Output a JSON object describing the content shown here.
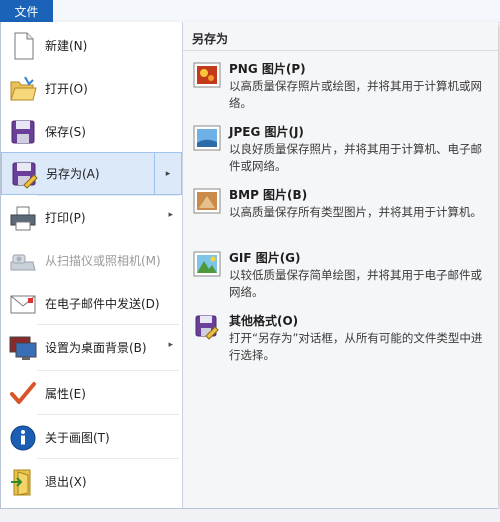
{
  "tab": {
    "label": "文件"
  },
  "left_menu": {
    "items": [
      {
        "label": "新建(N)",
        "icon": "new-document-icon"
      },
      {
        "label": "打开(O)",
        "icon": "open-folder-icon"
      },
      {
        "label": "保存(S)",
        "icon": "save-disk-icon"
      },
      {
        "label": "另存为(A)",
        "icon": "save-as-icon"
      },
      {
        "label": "打印(P)",
        "icon": "printer-icon"
      },
      {
        "label": "从扫描仪或照相机(M)",
        "icon": "scanner-icon"
      },
      {
        "label": "在电子邮件中发送(D)",
        "icon": "email-icon"
      },
      {
        "label": "设置为桌面背景(B)",
        "icon": "desktop-background-icon"
      },
      {
        "label": "属性(E)",
        "icon": "properties-check-icon"
      },
      {
        "label": "关于画图(T)",
        "icon": "info-icon"
      },
      {
        "label": "退出(X)",
        "icon": "exit-icon"
      }
    ],
    "submenu_arrow": "▸"
  },
  "save_as_pane": {
    "title": "另存为",
    "formats": [
      {
        "title": "PNG 图片(P)",
        "desc": "以高质量保存照片或绘图，并将其用于计算机或网络。",
        "icon": "png-image-icon"
      },
      {
        "title": "JPEG 图片(J)",
        "desc": "以良好质量保存照片，并将其用于计算机、电子邮件或网络。",
        "icon": "jpeg-image-icon"
      },
      {
        "title": "BMP 图片(B)",
        "desc": "以高质量保存所有类型图片，并将其用于计算机。",
        "icon": "bmp-image-icon"
      },
      {
        "title": "GIF 图片(G)",
        "desc": "以较低质量保存简单绘图，并将其用于电子邮件或网络。",
        "icon": "gif-image-icon"
      },
      {
        "title": "其他格式(O)",
        "desc": "打开“另存为”对话框，从所有可能的文件类型中进行选择。",
        "icon": "other-formats-icon"
      }
    ]
  },
  "colors": {
    "accent": "#1a63b8",
    "active_bg": "#dbe9f9",
    "pane_bg": "#f5f6f8"
  }
}
